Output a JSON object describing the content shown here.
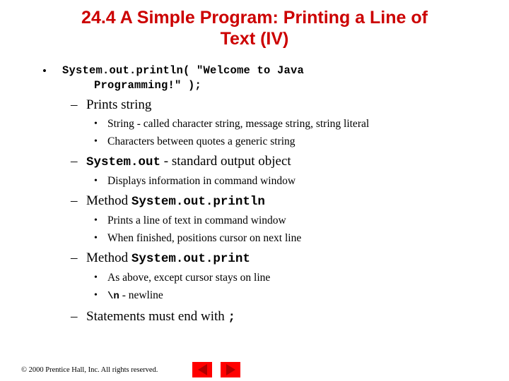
{
  "slide": {
    "title_line1": "24.4  A Simple Program: Printing a Line of",
    "title_line2": "Text (IV)",
    "title_color": "#cc0000",
    "background_color": "#ffffff",
    "bullets": {
      "b1_code_line1": "System.out.println( \"Welcome to Java",
      "b1_code_line2": "Programming!\" );",
      "b1_marker": "•",
      "b2_prints_string": "Prints string",
      "b2_marker": "–",
      "b3_string_called": "String - called character string, message string, string literal",
      "b3_characters_between": "Characters between quotes a generic string",
      "b3_marker": "•",
      "b2_systemout_code": "System.out",
      "b2_systemout_rest": " - standard output object",
      "b3_displays_info": "Displays information in command window",
      "b2_method_label": "Method ",
      "b2_method_println_code": "System.out.println",
      "b3_prints_line": "Prints a line of text in command window",
      "b3_when_finished": "When finished, positions cursor on next line",
      "b2_method_print_code": "System.out.print",
      "b3_as_above": "As above, except cursor stays on line",
      "b3_newline_code": "\\n",
      "b3_newline_rest": " - newline",
      "b2_statements_label": "Statements must end with ",
      "b2_statements_code": ";"
    }
  },
  "footer": {
    "copyright": "© 2000 Prentice Hall, Inc.  All rights reserved.",
    "prev_button_icon": "triangle-left",
    "next_button_icon": "triangle-right",
    "button_color": "#ff0000",
    "triangle_color": "#b00000"
  }
}
